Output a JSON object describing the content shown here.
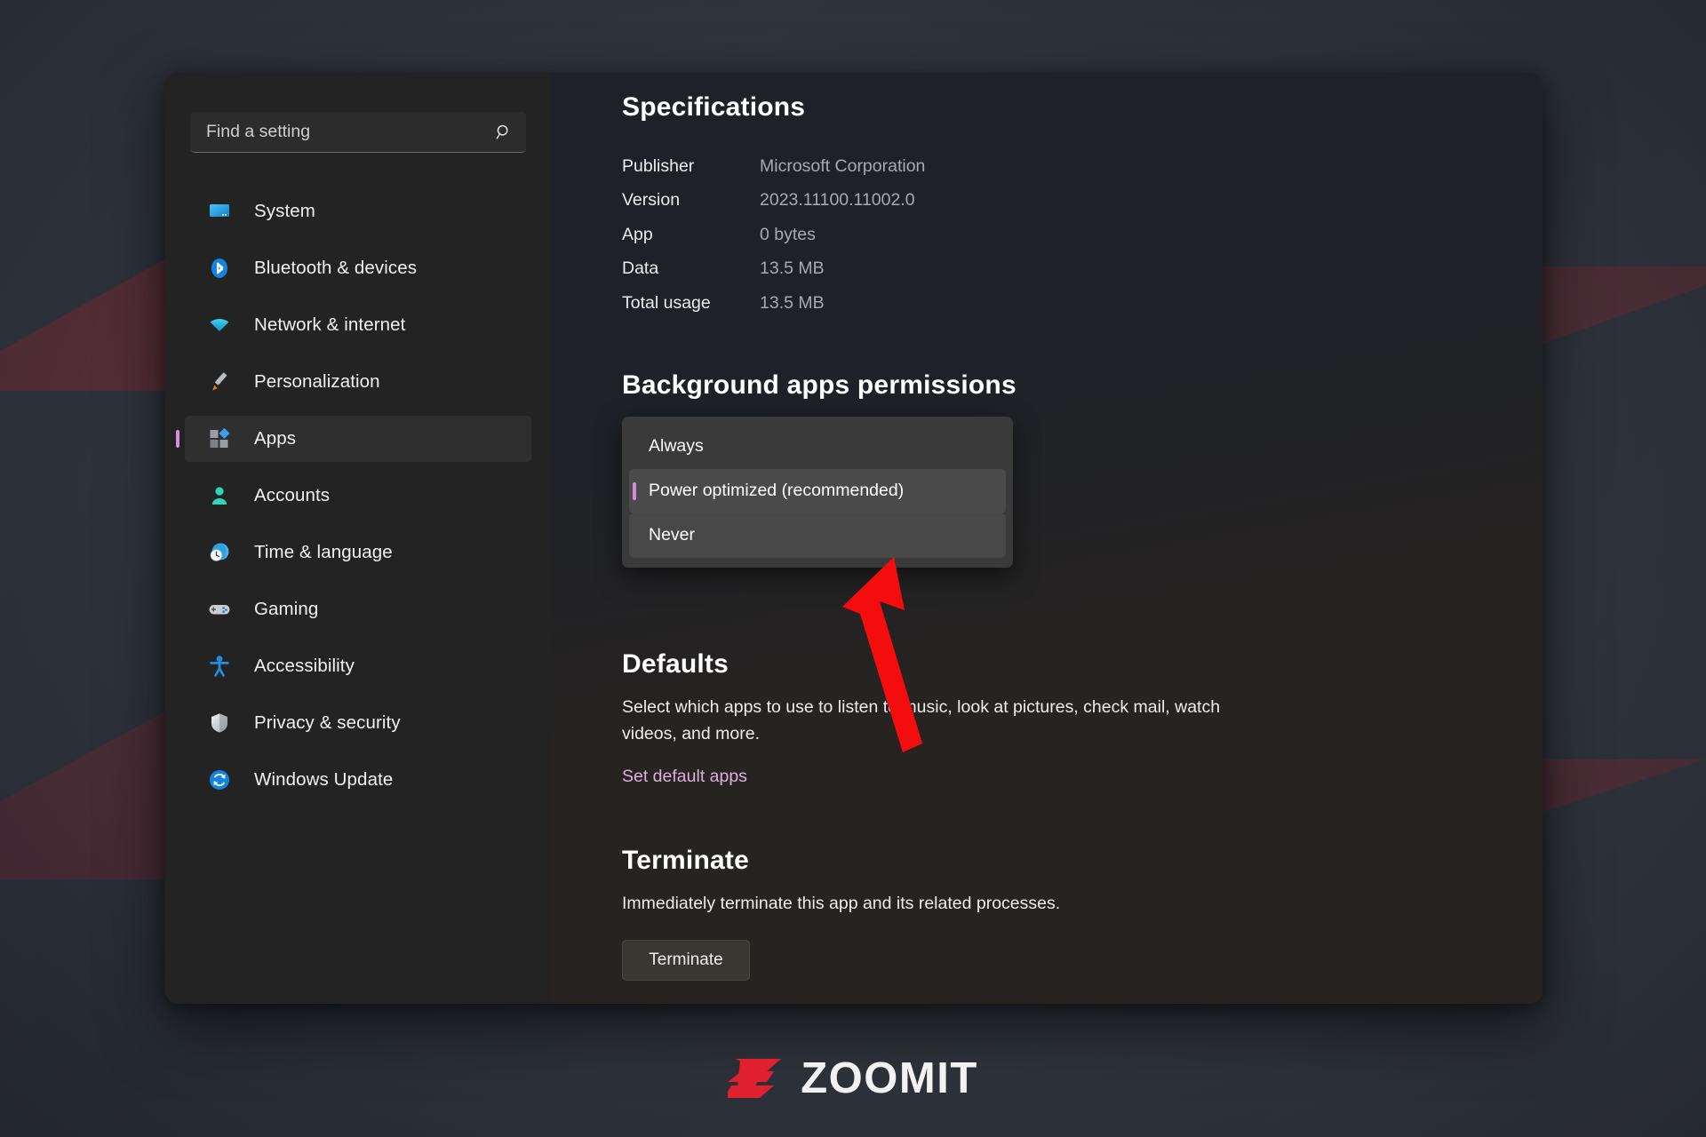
{
  "window": {
    "search": {
      "placeholder": "Find a setting",
      "value": "",
      "icon": "search-icon"
    },
    "sidebar": {
      "items": [
        {
          "label": "System",
          "icon": "monitor-icon",
          "selected": false
        },
        {
          "label": "Bluetooth & devices",
          "icon": "bluetooth-icon",
          "selected": false
        },
        {
          "label": "Network & internet",
          "icon": "wifi-icon",
          "selected": false
        },
        {
          "label": "Personalization",
          "icon": "paintbrush-icon",
          "selected": false
        },
        {
          "label": "Apps",
          "icon": "apps-icon",
          "selected": true
        },
        {
          "label": "Accounts",
          "icon": "person-icon",
          "selected": false
        },
        {
          "label": "Time & language",
          "icon": "clock-globe-icon",
          "selected": false
        },
        {
          "label": "Gaming",
          "icon": "gamepad-icon",
          "selected": false
        },
        {
          "label": "Accessibility",
          "icon": "accessibility-icon",
          "selected": false
        },
        {
          "label": "Privacy & security",
          "icon": "shield-icon",
          "selected": false
        },
        {
          "label": "Windows Update",
          "icon": "update-icon",
          "selected": false
        }
      ]
    },
    "content": {
      "specifications": {
        "title": "Specifications",
        "rows": [
          {
            "key": "Publisher",
            "value": "Microsoft Corporation"
          },
          {
            "key": "Version",
            "value": "2023.11100.11002.0"
          },
          {
            "key": "App",
            "value": "0 bytes"
          },
          {
            "key": "Data",
            "value": "13.5 MB"
          },
          {
            "key": "Total usage",
            "value": "13.5 MB"
          }
        ]
      },
      "background_apps": {
        "title": "Background apps permissions",
        "options": [
          {
            "label": "Always",
            "state": "normal"
          },
          {
            "label": "Power optimized (recommended)",
            "state": "selected"
          },
          {
            "label": "Never",
            "state": "hovered"
          }
        ],
        "selected_value": "Power optimized (recommended)",
        "accent_color": "#d48cdb"
      },
      "defaults": {
        "title": "Defaults",
        "description": "Select which apps to use to listen to music, look at pictures, check mail, watch videos, and more.",
        "link_label": "Set default apps",
        "link_color": "#dcb0dc"
      },
      "terminate": {
        "title": "Terminate",
        "description": "Immediately terminate this app and its related processes.",
        "button_label": "Terminate"
      }
    }
  },
  "annotation": {
    "arrow_color": "#f50d0d",
    "points_to": "Never"
  },
  "watermark": {
    "text": "ZOOMIT",
    "mark_color": "#e0202e",
    "text_color": "#f2f2f2"
  }
}
